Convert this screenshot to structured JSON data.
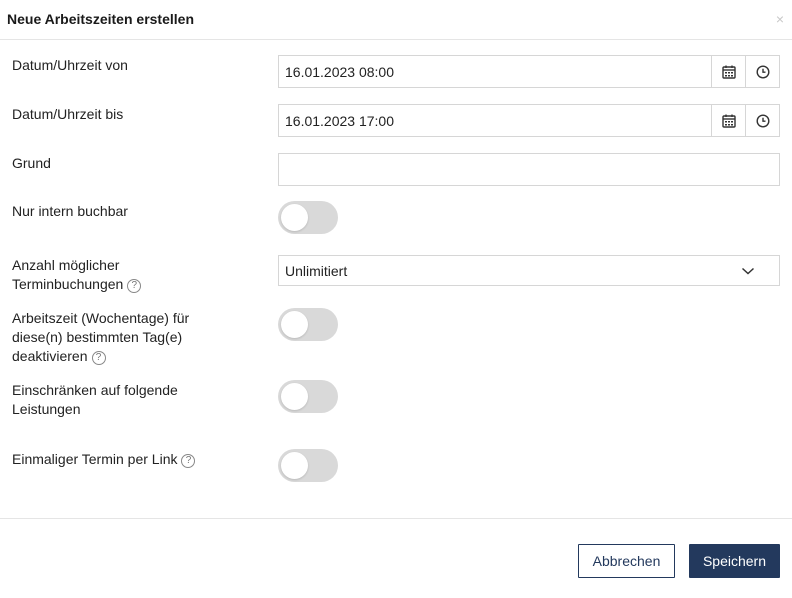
{
  "dialog": {
    "title": "Neue Arbeitszeiten erstellen",
    "close_symbol": "×"
  },
  "fields": {
    "start": {
      "label": "Datum/Uhrzeit von",
      "value": "16.01.2023 08:00"
    },
    "end": {
      "label": "Datum/Uhrzeit bis",
      "value": "16.01.2023 17:00"
    },
    "reason": {
      "label": "Grund",
      "value": ""
    },
    "internal_only": {
      "label": "Nur intern buchbar",
      "checked": false
    },
    "bookings_count": {
      "label_line1": "Anzahl möglicher",
      "label_line2": "Terminbuchungen",
      "value": "Unlimitiert"
    },
    "deactivate_workdays": {
      "label_line1": "Arbeitszeit (Wochentage) für",
      "label_line2": "diese(n) bestimmten Tag(e)",
      "label_line3": "deaktivieren",
      "checked": false
    },
    "restrict_services": {
      "label_line1": "Einschränken auf folgende",
      "label_line2": "Leistungen",
      "checked": false
    },
    "one_time_link": {
      "label": "Einmaliger Termin per Link",
      "checked": false
    }
  },
  "help_symbol": "?",
  "footer": {
    "cancel_label": "Abbrechen",
    "save_label": "Speichern"
  },
  "colors": {
    "primary": "#23395d",
    "toggle_off": "#d9d9d9",
    "border": "#d6d6d6"
  }
}
